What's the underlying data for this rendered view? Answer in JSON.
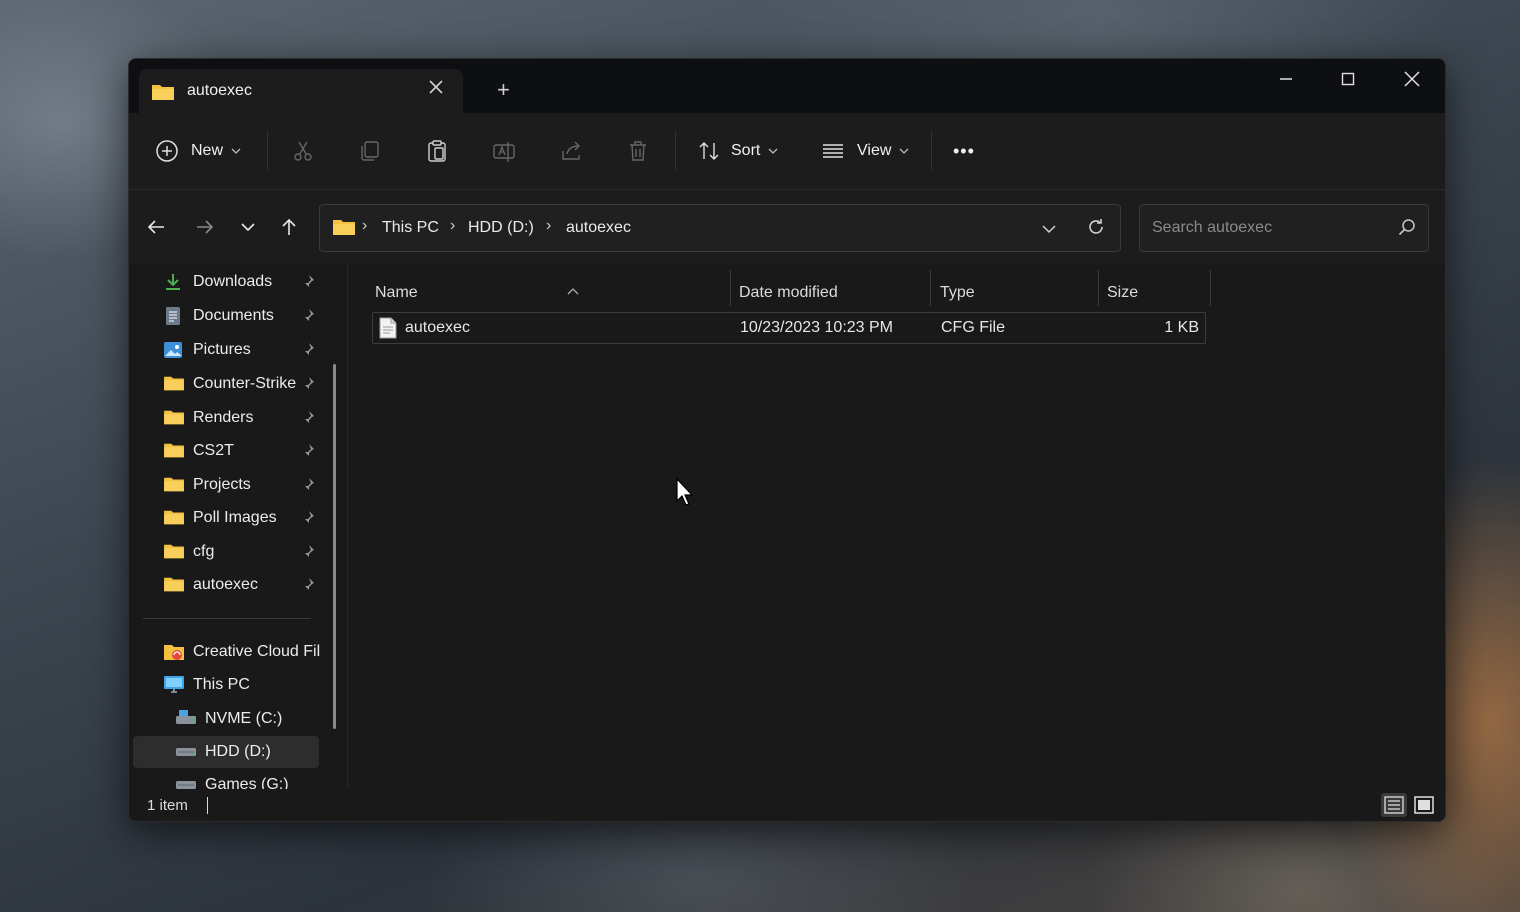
{
  "window": {
    "tab_title": "autoexec",
    "new_tab_label": "+",
    "minimize_label": "—",
    "maximize_label": "☐",
    "close_label": "✕"
  },
  "toolbar": {
    "new_label": "New",
    "sort_label": "Sort",
    "view_label": "View",
    "more_label": "•••"
  },
  "address": {
    "crumbs": [
      "This PC",
      "HDD (D:)",
      "autoexec"
    ],
    "separator": "›",
    "search_placeholder": "Search autoexec"
  },
  "sidebar": {
    "quick_access": [
      {
        "label": "Downloads",
        "icon": "download-icon"
      },
      {
        "label": "Documents",
        "icon": "document-icon"
      },
      {
        "label": "Pictures",
        "icon": "pictures-icon"
      },
      {
        "label": "Counter-Strike",
        "icon": "folder-icon"
      },
      {
        "label": "Renders",
        "icon": "folder-icon"
      },
      {
        "label": "CS2T",
        "icon": "folder-icon"
      },
      {
        "label": "Projects",
        "icon": "folder-icon"
      },
      {
        "label": "Poll Images",
        "icon": "folder-icon"
      },
      {
        "label": "cfg",
        "icon": "folder-icon"
      },
      {
        "label": "autoexec",
        "icon": "folder-icon"
      }
    ],
    "locations": [
      {
        "label": "Creative Cloud Fil",
        "icon": "creative-cloud-icon"
      },
      {
        "label": "This PC",
        "icon": "computer-icon"
      },
      {
        "label": "NVME (C:)",
        "icon": "drive-icon"
      },
      {
        "label": "HDD (D:)",
        "icon": "drive-icon",
        "selected": true
      },
      {
        "label": "Games (G:)",
        "icon": "drive-icon"
      }
    ]
  },
  "columns": {
    "name": "Name",
    "date": "Date modified",
    "type": "Type",
    "size": "Size"
  },
  "files": [
    {
      "name": "autoexec",
      "date": "10/23/2023 10:23 PM",
      "type": "CFG File",
      "size": "1 KB"
    }
  ],
  "status": {
    "count": "1 item"
  },
  "colors": {
    "folder": "#f4c141",
    "window_bg": "#191919",
    "titlebar_bg": "#0d0f12"
  }
}
